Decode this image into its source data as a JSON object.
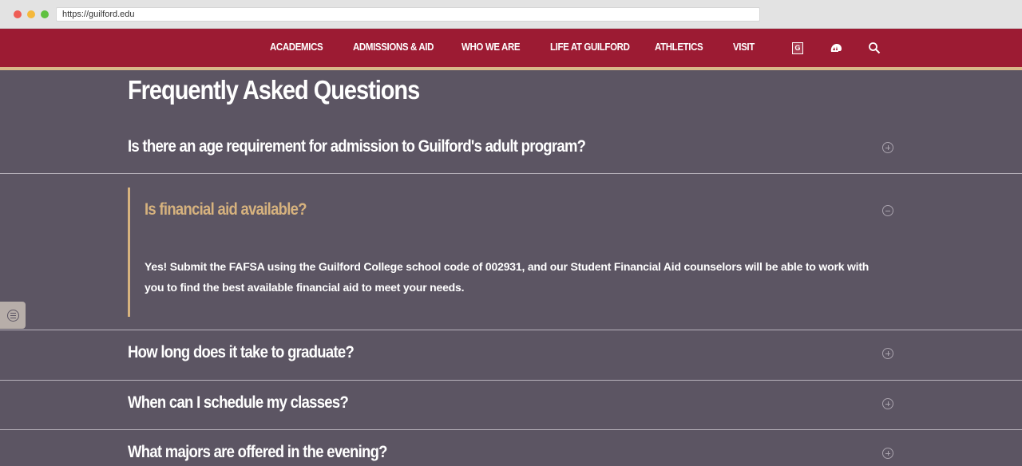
{
  "browser": {
    "url": "https://guilford.edu"
  },
  "nav": {
    "items": [
      {
        "label": "ACADEMICS"
      },
      {
        "label": "ADMISSIONS & AID"
      },
      {
        "label": "WHO WE ARE"
      },
      {
        "label": "LIFE AT GUILFORD"
      },
      {
        "label": "ATHLETICS"
      },
      {
        "label": "VISIT"
      }
    ],
    "icons": [
      "g-logo-icon",
      "quaker-mascot-icon",
      "search-icon"
    ],
    "g_letter": "G"
  },
  "page": {
    "title": "Frequently Asked Questions"
  },
  "faq": [
    {
      "question": "Is there an age requirement for admission to Guilford's adult program?",
      "state": "collapsed"
    },
    {
      "question": "Is financial aid available?",
      "state": "expanded",
      "answer": "Yes! Submit the FAFSA using the Guilford College school code of 002931, and our Student Financial Aid counselors will be able to work with you to find the best available financial aid to meet your needs."
    },
    {
      "question": "How long does it take to graduate?",
      "state": "collapsed"
    },
    {
      "question": "When can I schedule my classes?",
      "state": "collapsed"
    },
    {
      "question": "What majors are offered in the evening?",
      "state": "collapsed"
    }
  ],
  "colors": {
    "nav_bg": "#9c1b33",
    "gold_accent": "#d6b27e",
    "page_bg": "#5c5563"
  }
}
